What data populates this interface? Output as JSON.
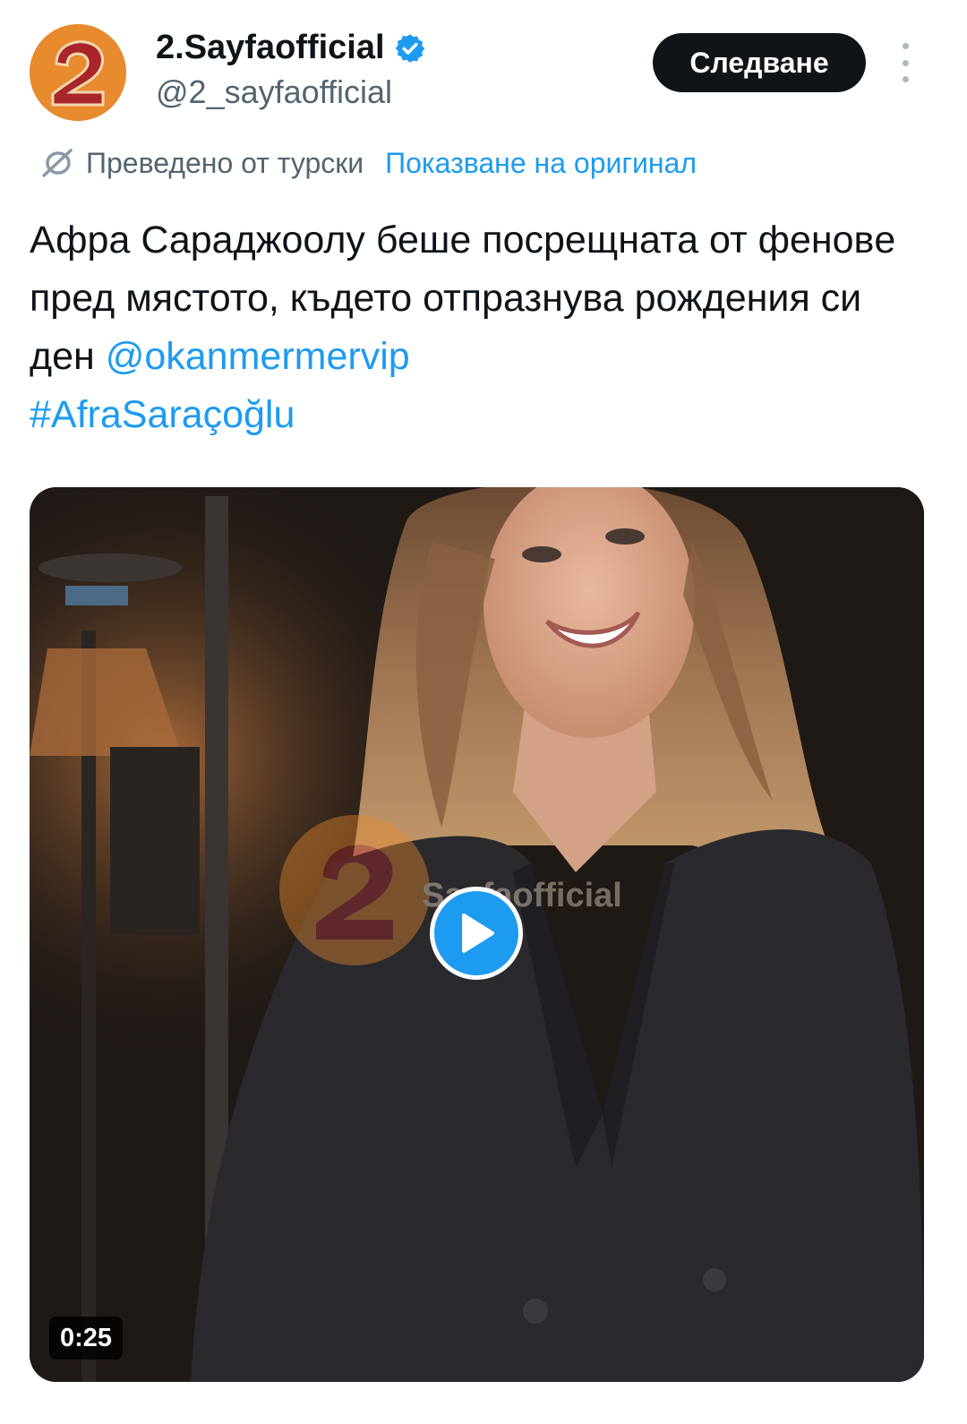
{
  "author": {
    "display_name": "2.Sayfaofficial",
    "handle": "@2_sayfaofficial",
    "verified": true,
    "avatar_text": "2",
    "avatar_color": "#e88a2e"
  },
  "header": {
    "follow_label": "Следване",
    "more_icon": "more-vertical-icon"
  },
  "translation": {
    "label": "Преведено от турски",
    "show_original_label": "Показване на оригинал",
    "icon": "translate-icon"
  },
  "tweet": {
    "text_part1": "Афра Сараджоолу беше посрещната от феновe пред мястото, където отпразнува рождения си ден ",
    "mention": "@okanmermervip",
    "hashtag": "#AfraSaraçoğlu"
  },
  "media": {
    "type": "video",
    "duration": "0:25",
    "watermark_text": "Sayfaofficial",
    "watermark_logo": "2",
    "play_icon": "play-icon"
  },
  "colors": {
    "accent": "#1d9bf0",
    "text_primary": "#0f1419",
    "text_secondary": "#536471",
    "button_bg": "#0f1419"
  }
}
